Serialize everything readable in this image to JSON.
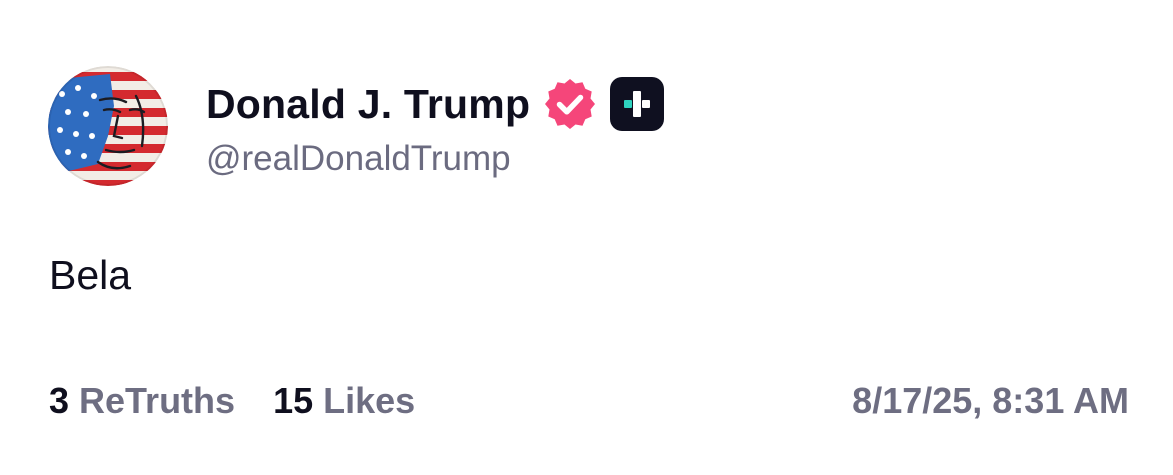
{
  "author": {
    "display_name": "Donald J. Trump",
    "handle": "@realDonaldTrump",
    "avatar_icon": "flag-portrait-avatar",
    "verified_icon": "verified-badge-icon",
    "verified_color": "#f5467a",
    "plus_icon": "truth-plus-badge-icon",
    "plus_color": "#2ed3bf"
  },
  "post": {
    "text": "Bela"
  },
  "stats": {
    "retruths_count": "3",
    "retruths_label": "ReTruths",
    "likes_count": "15",
    "likes_label": "Likes"
  },
  "timestamp": "8/17/25, 8:31 AM"
}
